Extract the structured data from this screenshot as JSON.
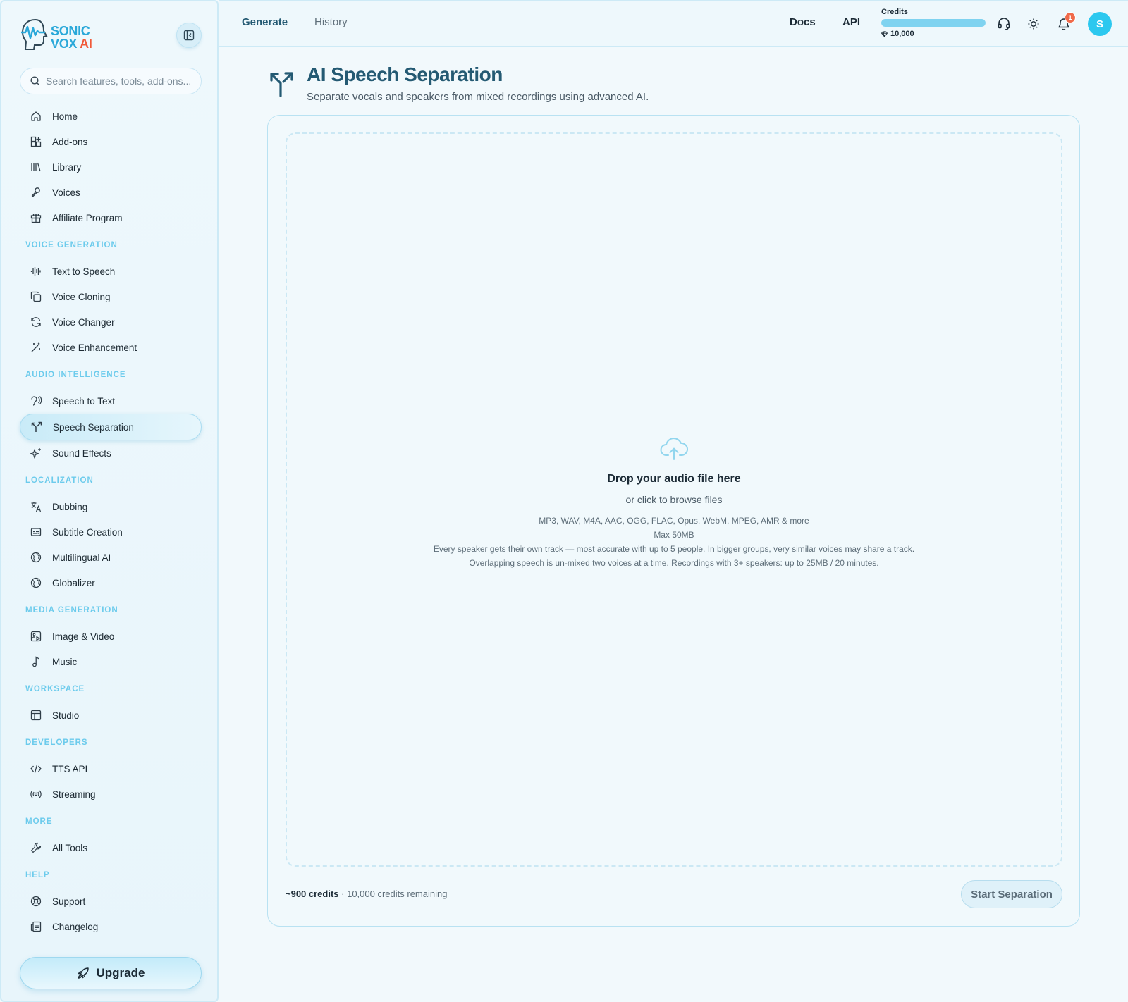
{
  "brand": {
    "line1": "SONIC",
    "line2": "VOX",
    "line2_accent": "AI"
  },
  "search": {
    "placeholder": "Search features, tools, add-ons..."
  },
  "sidebar": {
    "top_items": [
      {
        "label": "Home",
        "icon": "home-icon"
      },
      {
        "label": "Add-ons",
        "icon": "grid-plus-icon"
      },
      {
        "label": "Library",
        "icon": "library-icon"
      },
      {
        "label": "Voices",
        "icon": "microphone-icon"
      },
      {
        "label": "Affiliate Program",
        "icon": "gift-icon"
      }
    ],
    "sections": [
      {
        "title": "VOICE GENERATION",
        "items": [
          {
            "label": "Text to Speech",
            "icon": "audio-waveform-icon"
          },
          {
            "label": "Voice Cloning",
            "icon": "copy-icon"
          },
          {
            "label": "Voice Changer",
            "icon": "refresh-icon"
          },
          {
            "label": "Voice Enhancement",
            "icon": "magic-wand-icon"
          }
        ]
      },
      {
        "title": "AUDIO INTELLIGENCE",
        "items": [
          {
            "label": "Speech to Text",
            "icon": "ear-icon"
          },
          {
            "label": "Speech Separation",
            "icon": "split-icon",
            "active": true
          },
          {
            "label": "Sound Effects",
            "icon": "sparkles-icon"
          }
        ]
      },
      {
        "title": "LOCALIZATION",
        "items": [
          {
            "label": "Dubbing",
            "icon": "translate-icon"
          },
          {
            "label": "Subtitle Creation",
            "icon": "captions-icon"
          },
          {
            "label": "Multilingual AI",
            "icon": "globe-icon"
          },
          {
            "label": "Globalizer",
            "icon": "globe-icon"
          }
        ]
      },
      {
        "title": "MEDIA GENERATION",
        "items": [
          {
            "label": "Image & Video",
            "icon": "image-play-icon"
          },
          {
            "label": "Music",
            "icon": "music-note-icon"
          }
        ]
      },
      {
        "title": "WORKSPACE",
        "items": [
          {
            "label": "Studio",
            "icon": "layout-icon"
          }
        ]
      },
      {
        "title": "DEVELOPERS",
        "items": [
          {
            "label": "TTS API",
            "icon": "code-icon"
          },
          {
            "label": "Streaming",
            "icon": "radio-icon"
          }
        ]
      },
      {
        "title": "MORE",
        "items": [
          {
            "label": "All Tools",
            "icon": "wrench-icon"
          }
        ]
      },
      {
        "title": "HELP",
        "items": [
          {
            "label": "Support",
            "icon": "lifebuoy-icon"
          },
          {
            "label": "Changelog",
            "icon": "newspaper-icon"
          }
        ]
      }
    ],
    "upgrade_label": "Upgrade"
  },
  "topbar": {
    "tabs": [
      "Generate",
      "History"
    ],
    "docs_label": "Docs",
    "api_label": "API",
    "credits_label": "Credits",
    "credits_amount": "10,000",
    "credits_fill_percent": 100,
    "notification_count": "1",
    "avatar_initial": "S"
  },
  "main": {
    "title": "AI Speech Separation",
    "subtitle": "Separate vocals and speakers from mixed recordings using advanced AI.",
    "dropzone": {
      "title": "Drop your audio file here",
      "subtitle": "or click to browse files",
      "formats": "MP3, WAV, M4A, AAC, OGG, FLAC, Opus, WebM, MPEG, AMR & more",
      "max_size": "Max 50MB",
      "note1": "Every speaker gets their own track — most accurate with up to 5 people. In bigger groups, very similar voices may share a track.",
      "note2": "Overlapping speech is un-mixed two voices at a time. Recordings with 3+ speakers: up to 25MB / 20 minutes."
    },
    "cost_label": "~900 credits",
    "remaining_label": " · 10,000 credits remaining",
    "start_button": "Start Separation"
  },
  "colors": {
    "accent": "#2aa8d9",
    "title": "#245a73",
    "brand_ai": "#f05a3a",
    "badge": "#f06a4a",
    "avatar": "#2cc8ef"
  }
}
